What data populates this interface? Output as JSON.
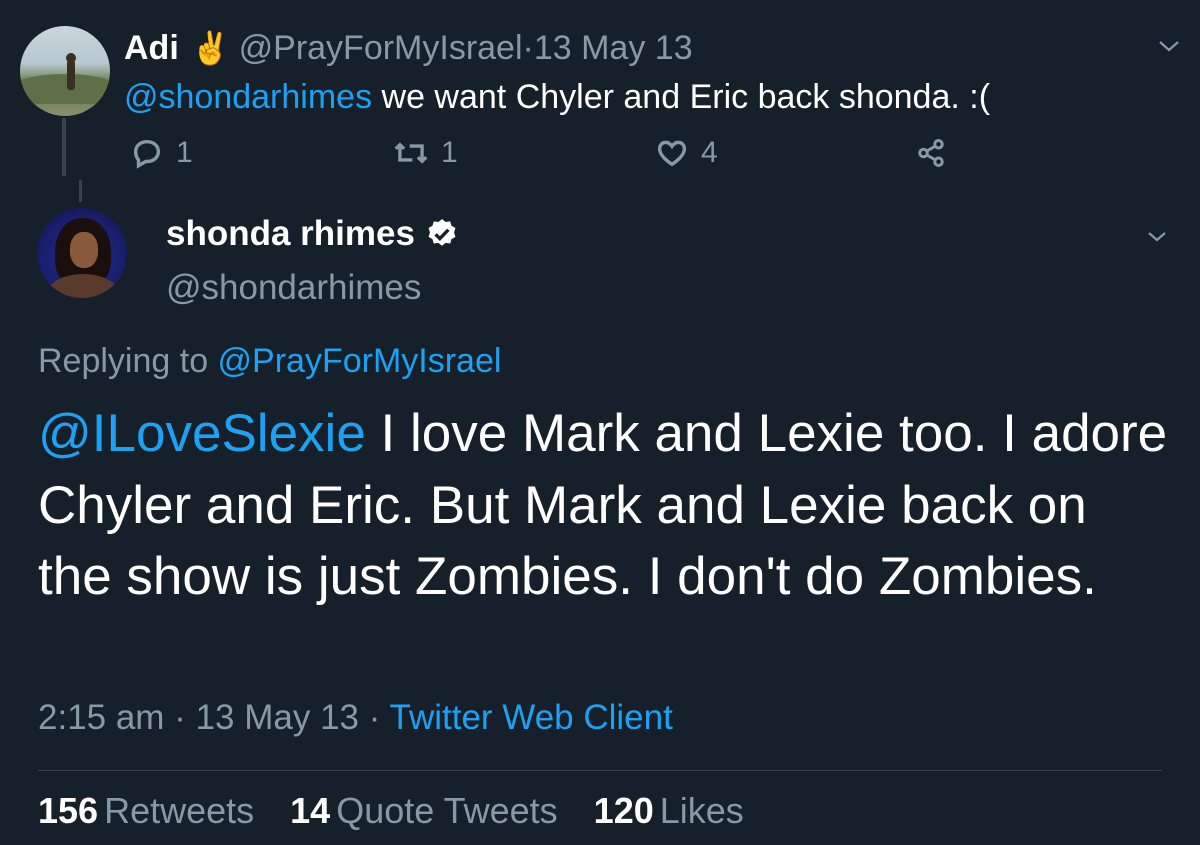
{
  "parent_tweet": {
    "display_name": "Adi",
    "emoji": "✌️",
    "handle": "@PrayForMyIsrael",
    "separator": " · ",
    "date": "13 May 13",
    "mention": "@shondarhimes",
    "text": " we want Chyler and Eric back shonda. :(",
    "reply_count": "1",
    "retweet_count": "1",
    "like_count": "4"
  },
  "main_tweet": {
    "display_name": "shonda rhimes",
    "handle": "@shondarhimes",
    "replying_prefix": "Replying to ",
    "replying_to": "@PrayForMyIsrael",
    "mention": "@ILoveSlexie",
    "text": " I love Mark and Lexie too.  I adore Chyler and Eric.  But Mark and Lexie back on the show is just Zombies.  I don't do Zombies.",
    "time": "2:15 am",
    "separator": " · ",
    "date": "13 May 13",
    "separator2": " · ",
    "client": "Twitter Web Client"
  },
  "stats": {
    "retweets_count": "156",
    "retweets_label": "Retweets",
    "quotes_count": "14",
    "quotes_label": "Quote Tweets",
    "likes_count": "120",
    "likes_label": "Likes"
  },
  "icons": {
    "reply": "reply-icon",
    "retweet": "retweet-icon",
    "like": "heart-icon",
    "share": "share-icon",
    "menu": "chevron-down-icon",
    "verified": "verified-badge-icon"
  },
  "colors": {
    "background": "#15202b",
    "accent": "#1da1f2",
    "secondary_text": "#8899a6",
    "divider": "#38444d"
  }
}
